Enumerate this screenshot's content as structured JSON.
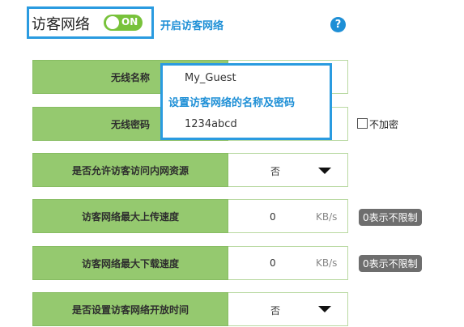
{
  "header": {
    "title": "访客网络",
    "toggle_label": "ON",
    "hint": "开启访客网络",
    "help": "?"
  },
  "wireless_name": {
    "label": "无线名称",
    "value": "My_Guest"
  },
  "wireless_password": {
    "label": "无线密码",
    "value": "1234abcd",
    "no_encrypt_label": "不加密"
  },
  "annotation": "设置访客网络的名称及密码",
  "allow_intranet": {
    "label": "是否允许访客访问内网资源",
    "value": "否"
  },
  "upload": {
    "label": "访客网络最大上传速度",
    "value": "0",
    "unit": "KB/s",
    "badge": "0表示不限制"
  },
  "download": {
    "label": "访客网络最大下载速度",
    "value": "0",
    "unit": "KB/s",
    "badge": "0表示不限制"
  },
  "open_time": {
    "label": "是否设置访客网络开放时间",
    "value": "否"
  },
  "colors": {
    "accent": "#1e8fd6",
    "label_bg": "#95c96f",
    "toggle_on": "#78c23b"
  }
}
